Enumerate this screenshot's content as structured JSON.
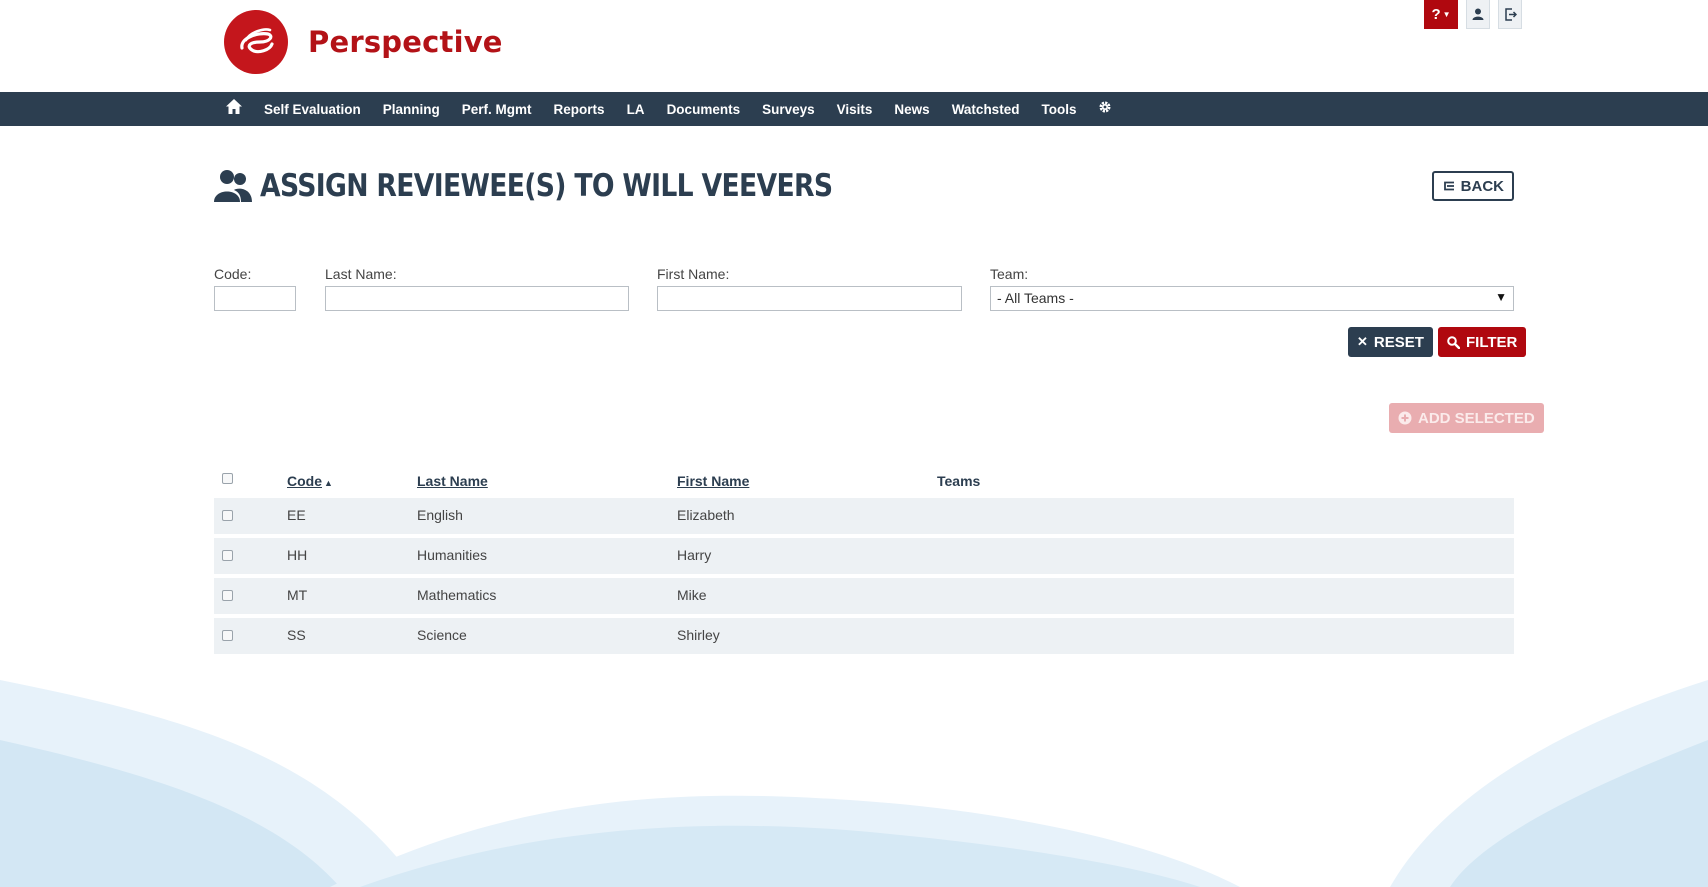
{
  "app": {
    "brand": "Perspective",
    "help_label": "?",
    "colors": {
      "accent": "#b0080f",
      "nav_bg": "#2c3e50",
      "title": "#2c3e50",
      "row_bg": "#edf1f4"
    }
  },
  "header": {
    "icons": [
      "help-icon",
      "user-icon",
      "logout-icon"
    ]
  },
  "nav": {
    "items": [
      "Self Evaluation",
      "Planning",
      "Perf. Mgmt",
      "Reports",
      "LA",
      "Documents",
      "Surveys",
      "Visits",
      "News",
      "Watchsted",
      "Tools"
    ]
  },
  "page": {
    "title": "ASSIGN REVIEWEE(S) TO WILL VEEVERS",
    "back_label": "BACK"
  },
  "filters": {
    "code_label": "Code:",
    "code_value": "",
    "last_name_label": "Last Name:",
    "last_name_value": "",
    "first_name_label": "First Name:",
    "first_name_value": "",
    "team_label": "Team:",
    "team_selected": "- All Teams -",
    "reset_label": "RESET",
    "filter_label": "FILTER",
    "add_selected_label": "ADD SELECTED"
  },
  "table": {
    "columns": {
      "code": "Code",
      "last_name": "Last Name",
      "first_name": "First Name",
      "teams": "Teams"
    },
    "rows": [
      {
        "code": "EE",
        "last_name": "English",
        "first_name": "Elizabeth",
        "teams": ""
      },
      {
        "code": "HH",
        "last_name": "Humanities",
        "first_name": "Harry",
        "teams": ""
      },
      {
        "code": "MT",
        "last_name": "Mathematics",
        "first_name": "Mike",
        "teams": ""
      },
      {
        "code": "SS",
        "last_name": "Science",
        "first_name": "Shirley",
        "teams": ""
      }
    ]
  }
}
